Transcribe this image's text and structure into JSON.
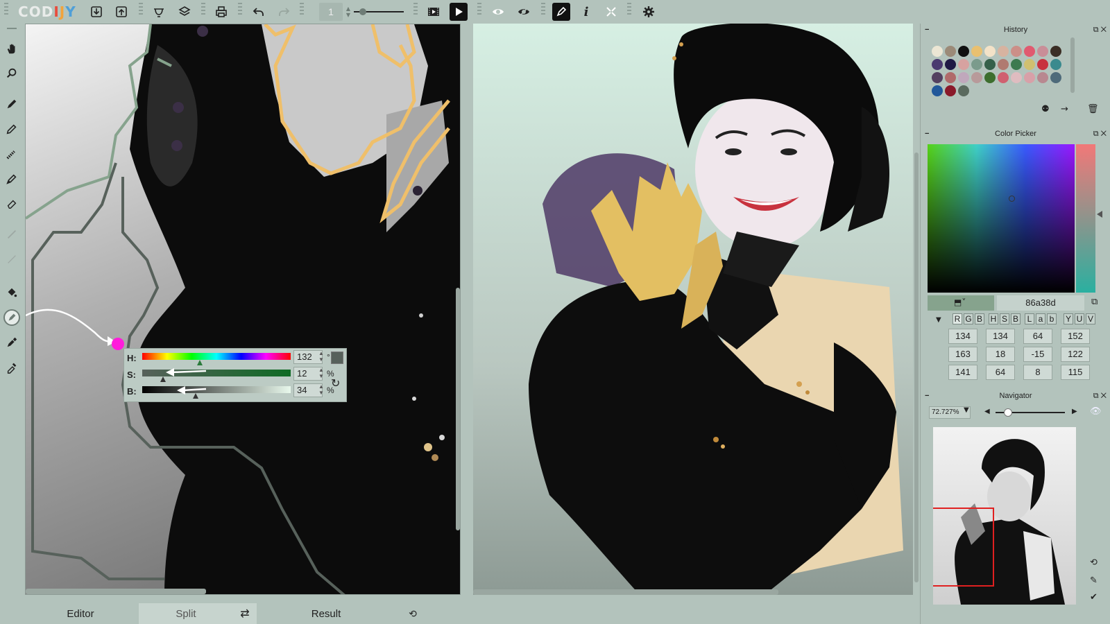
{
  "app": {
    "logo_text": "CODIJY"
  },
  "toolbar": {
    "items": [
      "import-icon",
      "export-icon",
      "palette-icon",
      "layers-icon",
      "print-icon",
      "undo-icon",
      "redo-icon"
    ],
    "brush_size": "1",
    "view_buttons": [
      "play-icon",
      "eye-icon",
      "eye-crossed-icon",
      "pen-icon",
      "info-icon",
      "expand-icon",
      "settings-icon"
    ]
  },
  "left_tools": [
    "hand-icon",
    "zoom-icon",
    "marker-icon",
    "pencil-icon",
    "dotted-brush-icon",
    "brush-icon",
    "eraser-icon",
    "disabled-tool-1",
    "disabled-tool-2",
    "bucket-icon",
    "color-marker-icon",
    "picker-pen-icon",
    "eyedropper-icon"
  ],
  "hsb_popup": {
    "h": {
      "label": "H:",
      "value": "132",
      "unit": "°"
    },
    "s": {
      "label": "S:",
      "value": "12",
      "unit": "%"
    },
    "b": {
      "label": "B:",
      "value": "34",
      "unit": "%"
    },
    "h_fraction": 0.37,
    "s_fraction": 0.12,
    "b_fraction": 0.34,
    "swatch": "#57615b"
  },
  "bottom_tabs": {
    "editor": "Editor",
    "split": "Split",
    "result": "Result"
  },
  "history": {
    "title": "History",
    "swatches": [
      "#ece6d4",
      "#9b8a78",
      "#101010",
      "#e9c070",
      "#f3e2c8",
      "#d7b3a0",
      "#cc8f88",
      "#e05a70",
      "#c98e98",
      "#3b2e25",
      "#4a3a70",
      "#1f1a45",
      "#d7a2a0",
      "#7b9b8c",
      "#35604a",
      "#b07a70",
      "#3d7a50",
      "#d0c070",
      "#c8323e",
      "#3a8a8e",
      "#544060",
      "#b06a6a",
      "#c0a8bc",
      "#b89a9a",
      "#3d6e2e",
      "#d06070",
      "#dfbcc0",
      "#d8a0a8",
      "#b88890",
      "#4e6a7a",
      "#22589a",
      "#8a1a2a",
      "#5a6a5e"
    ]
  },
  "color_picker": {
    "title": "Color Picker",
    "hex": "86a38d",
    "modes": [
      "R",
      "G",
      "B",
      "H",
      "S",
      "B",
      "L",
      "a",
      "b",
      "Y",
      "U",
      "V"
    ],
    "rgb": [
      "134",
      "163",
      "141"
    ],
    "hsb": [
      "134",
      "18",
      "64"
    ],
    "lab": [
      "64",
      "-15",
      "8"
    ],
    "yuv": [
      "152",
      "122",
      "115"
    ]
  },
  "navigator": {
    "title": "Navigator",
    "zoom": "72.727%"
  }
}
